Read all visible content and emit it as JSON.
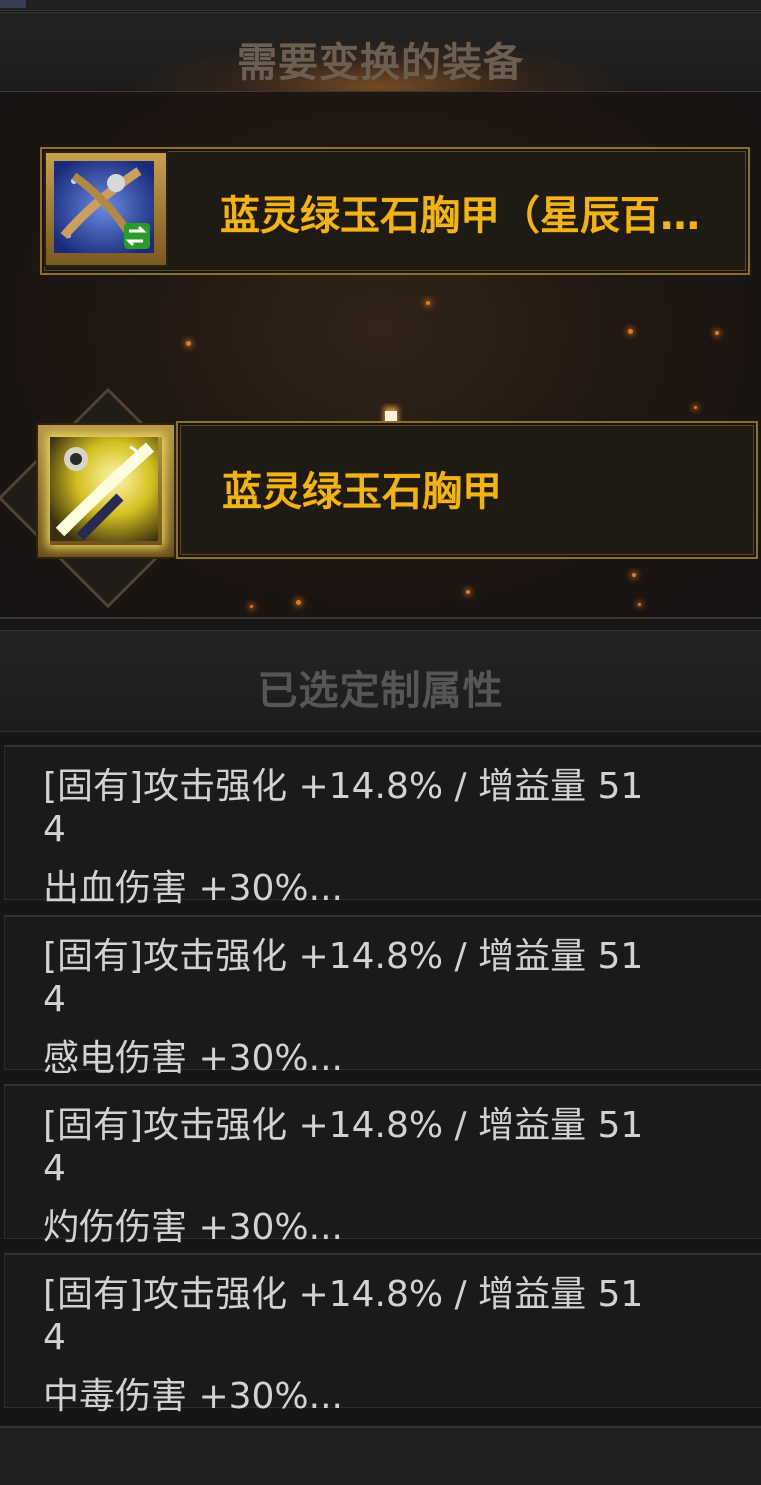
{
  "source_section": {
    "title": "需要变换的装备",
    "item_name": "蓝灵绿玉石胸甲（星辰百…"
  },
  "target_section": {
    "item_name": "蓝灵绿玉石胸甲"
  },
  "attributes_section": {
    "title": "已选定制属性",
    "items": [
      {
        "line1": "[固有]攻击强化 +14.8% / 增益量 51",
        "line2": "4",
        "line3": "出血伤害 +30%..."
      },
      {
        "line1": "[固有]攻击强化 +14.8% / 增益量 51",
        "line2": "4",
        "line3": "感电伤害 +30%..."
      },
      {
        "line1": "[固有]攻击强化 +14.8% / 增益量 51",
        "line2": "4",
        "line3": "灼伤伤害 +30%..."
      },
      {
        "line1": "[固有]攻击强化 +14.8% / 增益量 51",
        "line2": "4",
        "line3": "中毒伤害 +30%..."
      }
    ]
  },
  "colors": {
    "item_name": "#f0b418",
    "attribute_text": "#d2d2d2",
    "header_text": "#6c5f50",
    "accent_gold": "#8a7030"
  },
  "icons": {
    "source_item": "chest-armor-item-icon",
    "convert_badge": "swap-arrows-icon",
    "target_item": "chest-armor-item-icon",
    "transform_arrow": "arrow-down-icon"
  }
}
